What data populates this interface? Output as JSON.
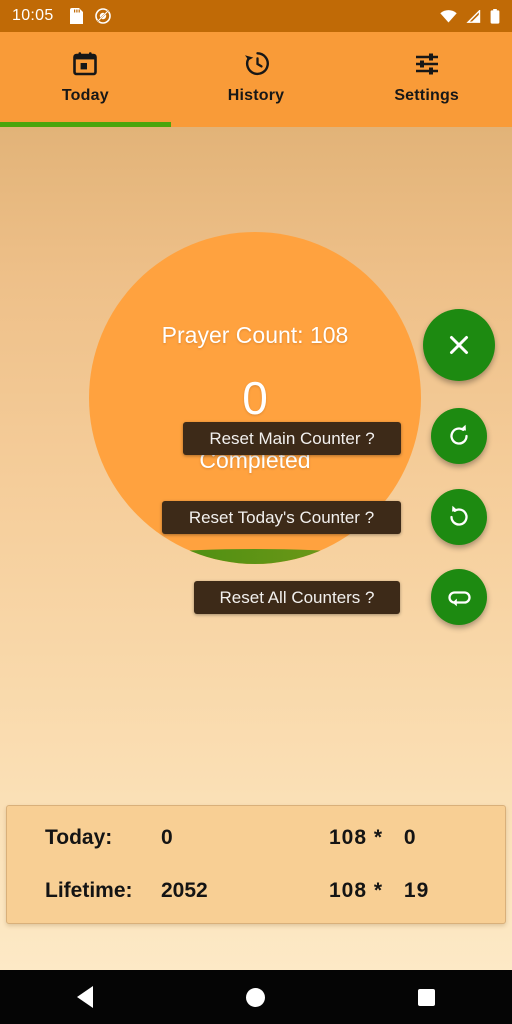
{
  "status_bar": {
    "time": "10:05",
    "left_icons": [
      "sd-card-icon",
      "do-not-disturb-icon"
    ],
    "right_icons": [
      "wifi-icon",
      "cellular-signal-icon",
      "battery-icon"
    ],
    "background_color": "#c06a06"
  },
  "tabs": {
    "active": "Today",
    "indicator_color": "#4ba50c",
    "bar_color": "#f99b38",
    "items": [
      {
        "label": "Today",
        "icon": "calendar-today-icon"
      },
      {
        "label": "History",
        "icon": "history-clock-icon"
      },
      {
        "label": "Settings",
        "icon": "tune-sliders-icon"
      }
    ]
  },
  "counter": {
    "prayer_count_label": "Prayer Count: 108",
    "current_value": "0",
    "completed_label": "Completed",
    "circle_color": "#ffa23f",
    "arc_color": "#2f8a0b"
  },
  "fabs": [
    {
      "name": "close-button",
      "icon": "close-x-icon",
      "color": "#1d8a11"
    },
    {
      "name": "redo-button",
      "icon": "redo-arrow-icon",
      "color": "#1d8a11"
    },
    {
      "name": "undo-button",
      "icon": "undo-arrow-icon",
      "color": "#1d8a11"
    },
    {
      "name": "loop-button",
      "icon": "loop-repeat-icon",
      "color": "#1d8a11"
    }
  ],
  "tooltips": {
    "reset_main": "Reset Main Counter ?",
    "reset_today": "Reset Today's Counter ?",
    "reset_all": "Reset All Counters ?",
    "background_color": "#3d2a18"
  },
  "stats": {
    "rows": [
      {
        "label": "Today:",
        "value": "0",
        "base": "108",
        "operator": "*",
        "multiplier": "0"
      },
      {
        "label": "Lifetime:",
        "value": "2052",
        "base": "108",
        "operator": "*",
        "multiplier": "19"
      }
    ],
    "panel_color": "#f8cf94"
  },
  "nav_bar": {
    "back": "back-triangle-icon",
    "home": "home-circle-icon",
    "recents": "recents-square-icon"
  }
}
